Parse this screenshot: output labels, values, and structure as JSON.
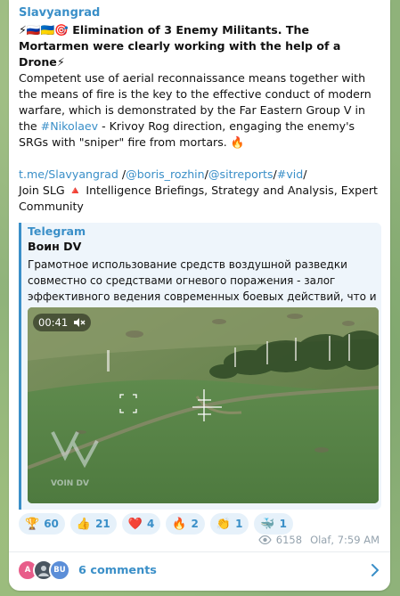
{
  "post": {
    "channel": "Slavyangrad",
    "headline_prefix": "⚡🇷🇺🇺🇦🎯",
    "headline": "Elimination of 3 Enemy Militants. The Mortarmen were clearly working with the help of a Drone",
    "headline_suffix": "⚡",
    "body_part1": "Competent use of aerial reconnaissance means together with the means of fire is the key to the effective conduct of modern warfare, which is demonstrated by the Far Eastern Group V in the ",
    "body_hashtag": "#Nikolaev",
    "body_part2": " - Krivoy Rog direction, engaging the enemy's SRGs with \"sniper\" fire from mortars. 🔥",
    "link1": "t.me/Slavyangrad",
    "sep1": " /",
    "link2": "@boris_rozhin",
    "sep2": "/",
    "link3": "@sitreports",
    "sep3": "/",
    "link4": "#vid",
    "sep4": "/",
    "join_text": "Join SLG 🔺 Intelligence Briefings, Strategy and Analysis, Expert Community"
  },
  "forwarded": {
    "source": "Telegram",
    "author": "Воин DV",
    "text": "Грамотное использование средств воздушной разведки совместно со средствами огневого поражения - залог эффективного ведения современных боевых действий, что и ...",
    "video": {
      "duration": "00:41",
      "muted_icon": "speaker-muted-icon",
      "watermark": "VOIN DV"
    }
  },
  "reactions": [
    {
      "icon": "trophy-icon",
      "glyph": "🏆",
      "count": "60"
    },
    {
      "icon": "thumbs-up-icon",
      "glyph": "👍",
      "count": "21"
    },
    {
      "icon": "heart-icon",
      "glyph": "❤️",
      "count": "4"
    },
    {
      "icon": "fire-icon",
      "glyph": "🔥",
      "count": "2"
    },
    {
      "icon": "clap-icon",
      "glyph": "👏",
      "count": "1"
    },
    {
      "icon": "whale-icon",
      "glyph": "🐳",
      "count": "1"
    }
  ],
  "meta": {
    "views": "6158",
    "author_time": "Olaf, 7:59 AM"
  },
  "comments": {
    "label": "6 comments",
    "avatars": [
      {
        "initials": "A",
        "color": "#e85d8a"
      },
      {
        "initials": "",
        "color": "#4a5560"
      },
      {
        "initials": "BU",
        "color": "#5b8ed8"
      }
    ]
  },
  "colors": {
    "accent": "#3a8fc8",
    "reaction_bg": "#e6f1fa",
    "background": "#8fb27a"
  }
}
